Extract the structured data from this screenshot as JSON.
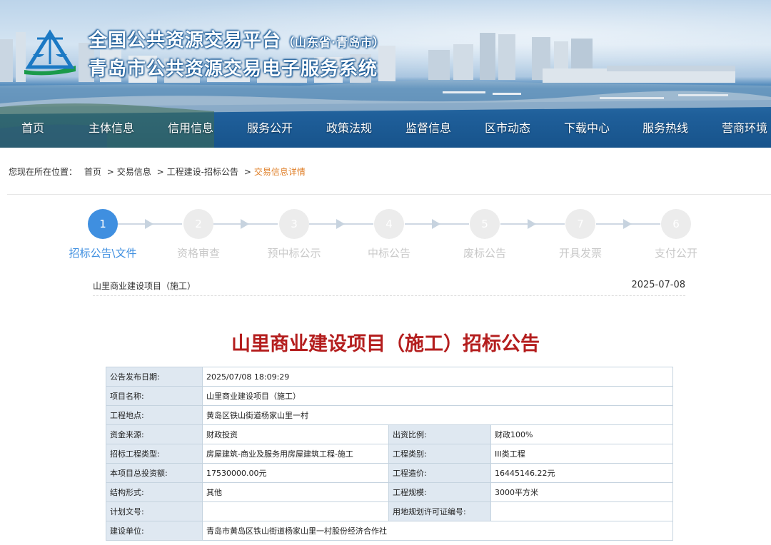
{
  "header": {
    "title_main": "全国公共资源交易平台",
    "title_region": "（山东省·青岛市）",
    "title_sub": "青岛市公共资源交易电子服务系统"
  },
  "nav": {
    "items": [
      {
        "label": "首页"
      },
      {
        "label": "主体信息"
      },
      {
        "label": "信用信息"
      },
      {
        "label": "服务公开"
      },
      {
        "label": "政策法规"
      },
      {
        "label": "监督信息"
      },
      {
        "label": "区市动态"
      },
      {
        "label": "下载中心"
      },
      {
        "label": "服务热线"
      },
      {
        "label": "营商环境"
      }
    ]
  },
  "breadcrumb": {
    "prefix": "您现在所在位置：",
    "items": [
      "首页",
      "交易信息",
      "工程建设-招标公告",
      "交易信息详情"
    ],
    "separator": ">"
  },
  "steps": [
    {
      "number": "1",
      "label": "招标公告\\文件",
      "active": true
    },
    {
      "number": "2",
      "label": "资格审查",
      "active": false
    },
    {
      "number": "3",
      "label": "预中标公示",
      "active": false
    },
    {
      "number": "4",
      "label": "中标公告",
      "active": false
    },
    {
      "number": "5",
      "label": "废标公告",
      "active": false
    },
    {
      "number": "7",
      "label": "开具发票",
      "active": false
    },
    {
      "number": "6",
      "label": "支付公开",
      "active": false
    }
  ],
  "project": {
    "name": "山里商业建设项目（施工）",
    "date": "2025-07-08",
    "notice_title": "山里商业建设项目（施工）招标公告"
  },
  "table": {
    "publish_date_label": "公告发布日期:",
    "publish_date": "2025/07/08 18:09:29",
    "project_name_label": "项目名称:",
    "project_name": "山里商业建设项目（施工）",
    "location_label": "工程地点:",
    "location": "黄岛区铁山街道杨家山里一村",
    "fund_source_label": "资金来源:",
    "fund_source": "财政投资",
    "fund_ratio_label": "出资比例:",
    "fund_ratio": "财政100%",
    "project_type_label": "招标工程类型:",
    "project_type": "房屋建筑-商业及服务用房屋建筑工程-施工",
    "project_category_label": "工程类别:",
    "project_category": "III类工程",
    "total_investment_label": "本项目总投资额:",
    "total_investment": "17530000.00元",
    "project_cost_label": "工程造价:",
    "project_cost": "16445146.22元",
    "structure_label": "结构形式:",
    "structure": "其他",
    "scale_label": "工程规模:",
    "scale": "3000平方米",
    "plan_doc_label": "计划文号:",
    "plan_doc": "",
    "land_permit_label": "用地规划许可证编号:",
    "land_permit": "",
    "builder_label": "建设单位:",
    "builder": "青岛市黄岛区铁山街道杨家山里一村股份经济合作社"
  },
  "colors": {
    "accent_blue": "#3f8fe0",
    "title_red": "#b41e1e",
    "breadcrumb_current": "#e0802a",
    "table_key_bg": "#dfe8f1"
  },
  "icons": {
    "logo": "scales-of-justice-logo"
  }
}
